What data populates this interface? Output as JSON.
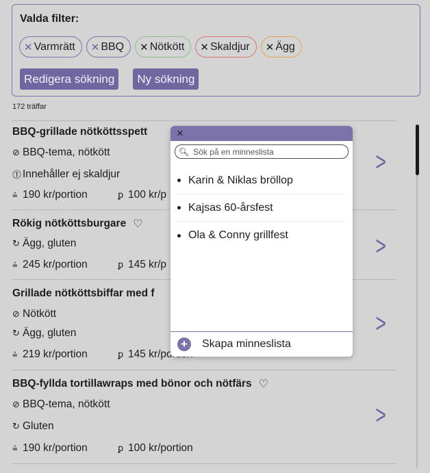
{
  "filters": {
    "title": "Valda filter:",
    "chips": [
      {
        "label": "Varmrätt"
      },
      {
        "label": "BBQ"
      },
      {
        "label": "Nötkött"
      },
      {
        "label": "Skaldjur"
      },
      {
        "label": "Ägg"
      }
    ],
    "edit_label": "Redigera sökning",
    "new_label": "Ny sökning"
  },
  "hits": "172 träffar",
  "recipes": [
    {
      "title": "BBQ-grillade nötköttsspett",
      "line1": "BBQ-tema, nötkött",
      "line2": "Innehåller ej skaldjur",
      "price1": "190 kr/portion",
      "price2": "100 kr/p"
    },
    {
      "title": "Rökig nötköttsburgare",
      "line1": "Ägg, gluten",
      "price1": "245 kr/portion",
      "price2": "145 kr/p"
    },
    {
      "title": "Grillade nötköttsbiffar med f",
      "line1": "Nötkött",
      "line2": "Ägg, gluten",
      "price1": "219 kr/portion",
      "price2": "145 kr/portion"
    },
    {
      "title": "BBQ-fyllda tortillawraps med bönor och nötfärs",
      "line1": "BBQ-tema, nötkött",
      "line2": "Gluten",
      "price1": "190 kr/portion",
      "price2": "100 kr/portion"
    }
  ],
  "popup": {
    "close": "×",
    "search_placeholder": "Sök på en minneslista",
    "items": [
      "Karin & Niklas bröllop",
      "Kajsas 60-årsfest",
      "Ola & Conny grillfest"
    ],
    "create_label": "Skapa minneslista"
  },
  "icons": {
    "chevron": "chevron-right-icon",
    "heart": "heart-icon"
  },
  "colors": {
    "accent": "#6f67a0",
    "background": "#d4d4d4"
  }
}
